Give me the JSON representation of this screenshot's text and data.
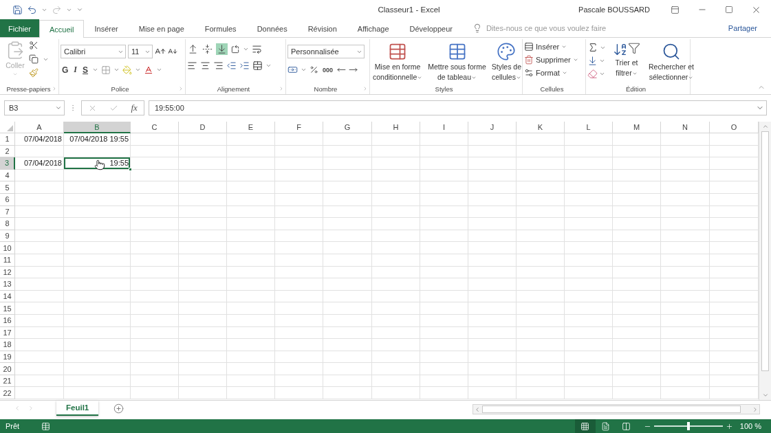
{
  "window": {
    "title": "Classeur1  -  Excel",
    "user": "Pascale BOUSSARD"
  },
  "tabs": [
    {
      "label": "Fichier",
      "kind": "file",
      "selected": false
    },
    {
      "label": "Accueil",
      "kind": "tab",
      "selected": true
    },
    {
      "label": "Insérer",
      "kind": "tab",
      "selected": false
    },
    {
      "label": "Mise en page",
      "kind": "tab",
      "selected": false
    },
    {
      "label": "Formules",
      "kind": "tab",
      "selected": false
    },
    {
      "label": "Données",
      "kind": "tab",
      "selected": false
    },
    {
      "label": "Révision",
      "kind": "tab",
      "selected": false
    },
    {
      "label": "Affichage",
      "kind": "tab",
      "selected": false
    },
    {
      "label": "Développeur",
      "kind": "tab",
      "selected": false
    }
  ],
  "tell_me": {
    "placeholder": "Dites-nous ce que vous voulez faire"
  },
  "share": "Partager",
  "ribbon": {
    "clipboard": {
      "label": "Presse-papiers",
      "paste": {
        "label": "Coller",
        "disabled": true
      }
    },
    "font": {
      "label": "Police",
      "name": "Calibri",
      "size": "11",
      "bold": "G",
      "italic": "I",
      "underline": "S"
    },
    "alignment": {
      "label": "Alignement",
      "vertical": [
        {
          "kind": "top",
          "selected": false
        },
        {
          "kind": "middle",
          "selected": false
        },
        {
          "kind": "bottom",
          "selected": true
        }
      ]
    },
    "number": {
      "label": "Nombre",
      "format": "Personnalisée",
      "thousands": "000"
    },
    "styles": {
      "label": "Styles",
      "buttons": [
        {
          "kind": "conditional",
          "lines": [
            "Mise en forme",
            "conditionnelle"
          ]
        },
        {
          "kind": "table",
          "lines": [
            "Mettre sous forme",
            "de tableau"
          ]
        },
        {
          "kind": "cell_styles",
          "lines": [
            "Styles de",
            "cellules"
          ]
        }
      ]
    },
    "cells": {
      "label": "Cellules",
      "buttons": [
        {
          "kind": "insert",
          "label": "Insérer"
        },
        {
          "kind": "delete",
          "label": "Supprimer"
        },
        {
          "kind": "format",
          "label": "Format"
        }
      ]
    },
    "editing": {
      "label": "Édition",
      "buttons": [
        {
          "kind": "sort",
          "lines": [
            "Trier et",
            "filtrer"
          ]
        },
        {
          "kind": "find",
          "lines": [
            "Rechercher et",
            "sélectionner"
          ]
        }
      ]
    }
  },
  "formula_bar": {
    "name_box": "B3",
    "function_label": "fx",
    "value": "19:55:00"
  },
  "grid": {
    "columns": [
      {
        "label": "A",
        "selected": false
      },
      {
        "label": "B",
        "selected": true
      },
      {
        "label": "C",
        "selected": false
      },
      {
        "label": "D",
        "selected": false
      },
      {
        "label": "E",
        "selected": false
      },
      {
        "label": "F",
        "selected": false
      },
      {
        "label": "G",
        "selected": false
      },
      {
        "label": "H",
        "selected": false
      },
      {
        "label": "I",
        "selected": false
      },
      {
        "label": "J",
        "selected": false
      },
      {
        "label": "K",
        "selected": false
      },
      {
        "label": "L",
        "selected": false
      },
      {
        "label": "M",
        "selected": false
      },
      {
        "label": "N",
        "selected": false
      },
      {
        "label": "O",
        "selected": false
      }
    ],
    "rows": [
      {
        "label": "1",
        "selected": false,
        "cells": [
          {
            "value": "07/04/2018",
            "selected": false
          },
          {
            "value": "07/04/2018 19:55",
            "selected": false
          }
        ]
      },
      {
        "label": "2",
        "selected": false
      },
      {
        "label": "3",
        "selected": true,
        "cells": [
          {
            "value": "07/04/2018",
            "selected": false
          },
          {
            "value": "19:55",
            "selected": true
          }
        ]
      },
      {
        "label": "4",
        "selected": false
      },
      {
        "label": "5",
        "selected": false
      },
      {
        "label": "6",
        "selected": false
      },
      {
        "label": "7",
        "selected": false
      },
      {
        "label": "8",
        "selected": false
      },
      {
        "label": "9",
        "selected": false
      },
      {
        "label": "10",
        "selected": false
      },
      {
        "label": "11",
        "selected": false
      },
      {
        "label": "12",
        "selected": false
      },
      {
        "label": "13",
        "selected": false
      },
      {
        "label": "14",
        "selected": false
      },
      {
        "label": "15",
        "selected": false
      },
      {
        "label": "16",
        "selected": false
      },
      {
        "label": "17",
        "selected": false
      },
      {
        "label": "18",
        "selected": false
      },
      {
        "label": "19",
        "selected": false
      },
      {
        "label": "20",
        "selected": false
      },
      {
        "label": "21",
        "selected": false
      },
      {
        "label": "22",
        "selected": false
      }
    ]
  },
  "sheets": [
    {
      "label": "Feuil1",
      "selected": true
    }
  ],
  "status_bar": {
    "text": "Prêt",
    "views": [
      {
        "kind": "normal",
        "selected": true
      },
      {
        "kind": "page_layout",
        "selected": false
      },
      {
        "kind": "page_break",
        "selected": false
      }
    ],
    "zoom": {
      "level": 0.5,
      "reading": "100 %"
    }
  }
}
